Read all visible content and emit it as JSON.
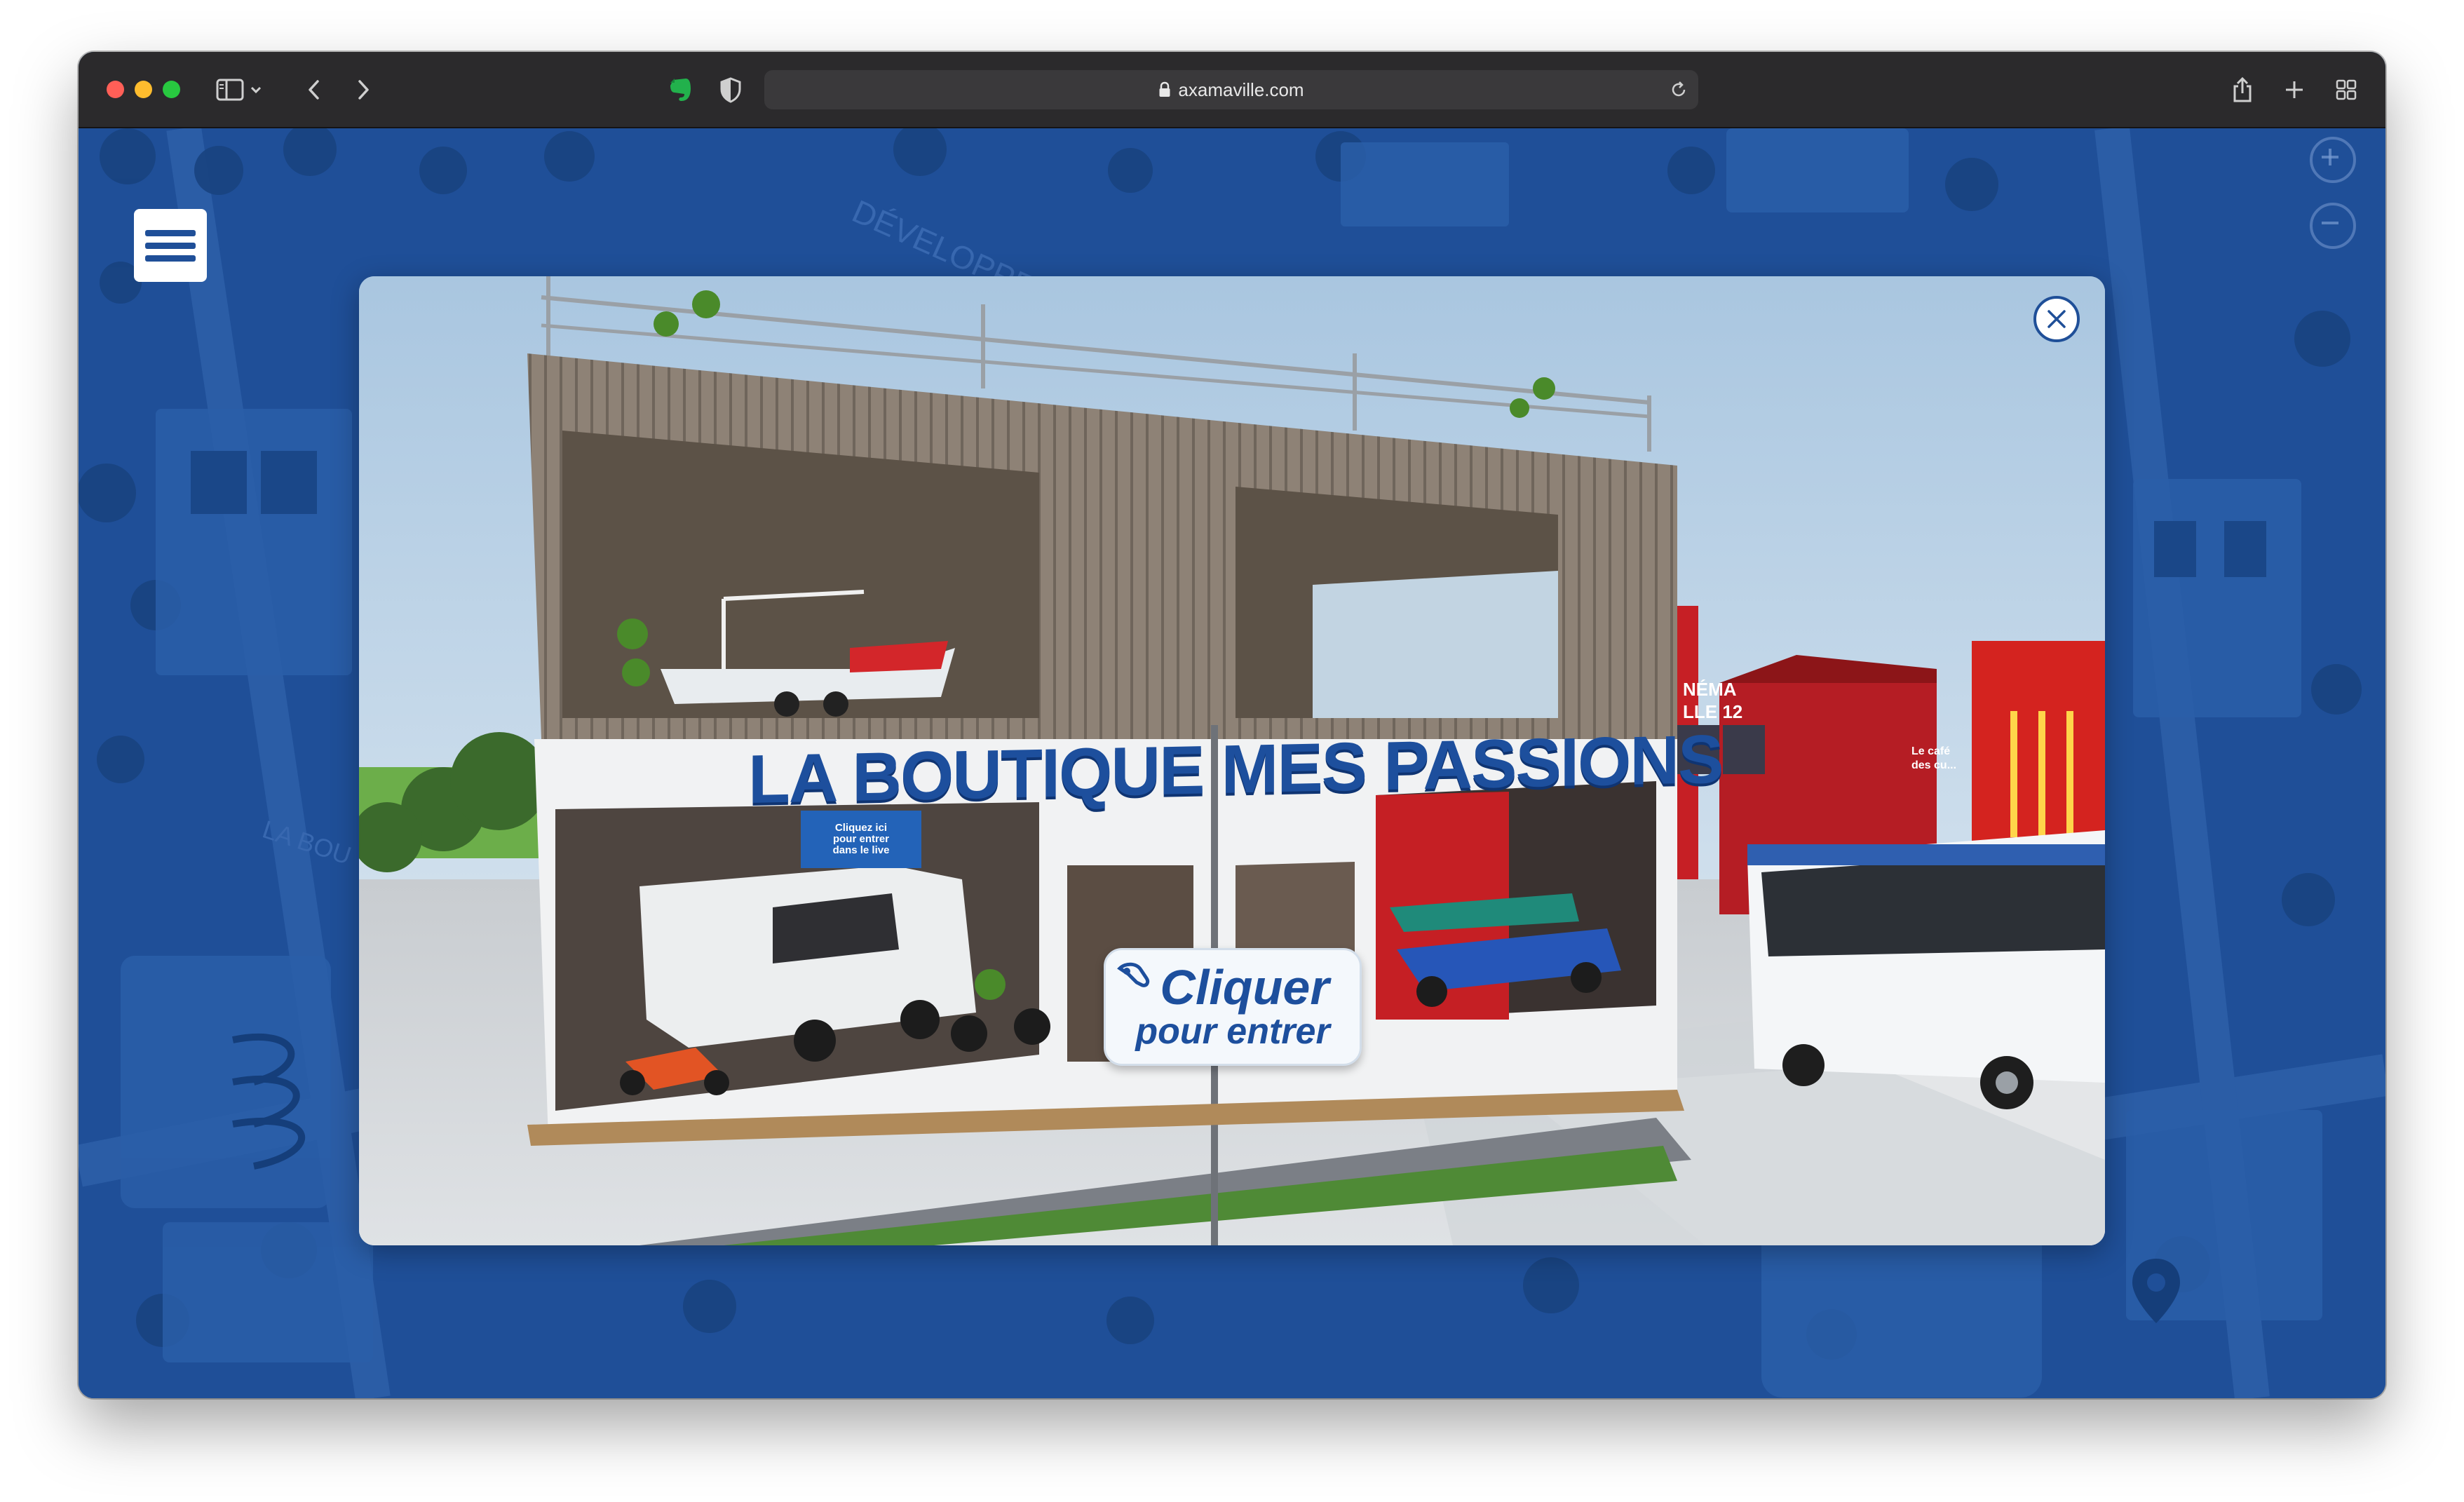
{
  "browser": {
    "url": "axamaville.com",
    "traffic_lights": {
      "close": "#ff5f57",
      "minimize": "#febc2e",
      "maximize": "#28c840"
    },
    "icons": [
      "sidebar-icon",
      "chevron-down-icon",
      "back-icon",
      "forward-icon",
      "evernote-icon",
      "shield-icon",
      "lock-icon",
      "reload-icon",
      "share-icon",
      "new-tab-icon",
      "tab-overview-icon"
    ]
  },
  "page": {
    "background_color": "#1f4f98",
    "menu_icon": "hamburger-icon",
    "zoom_in_icon": "plus-icon",
    "zoom_out_icon": "minus-icon",
    "location_icon": "map-pin-icon"
  },
  "modal": {
    "close_icon": "close-icon",
    "store_sign": "LA BOUTIQUE MES PASSIONS",
    "enter_button": {
      "line1": "Cliquer",
      "line2": "pour entrer"
    },
    "screen_sign": {
      "line1": "Cliquez ici",
      "line2": "pour entrer",
      "line3": "dans le live"
    },
    "cinema_sign": {
      "line1": "NÉMA",
      "line2": "LLE 12"
    },
    "cafe_sign": {
      "line1": "Le café",
      "line2": "des cu..."
    }
  }
}
